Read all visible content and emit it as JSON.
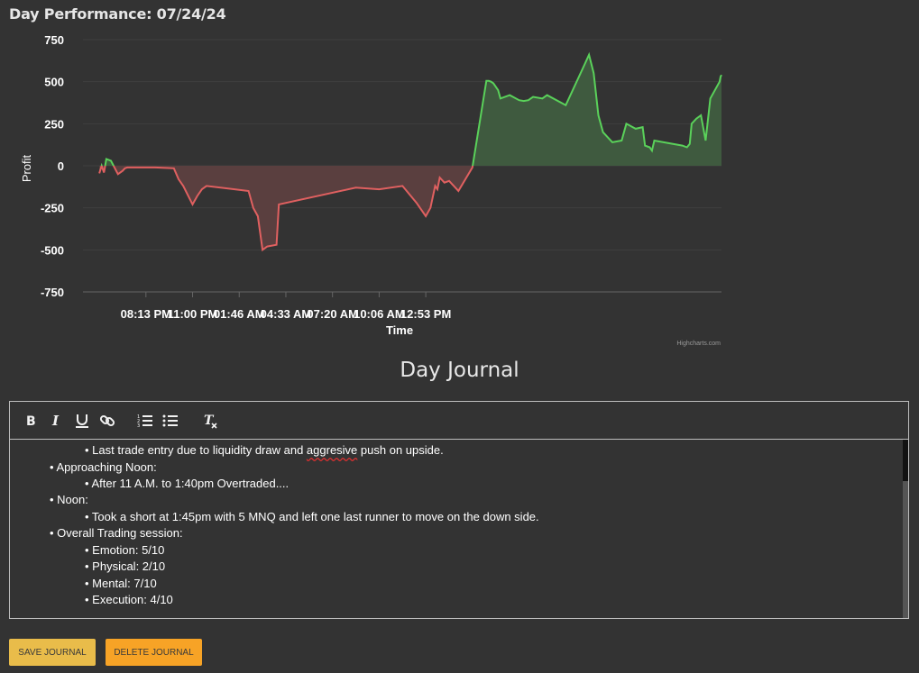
{
  "header": {
    "title": "Day Performance: 07/24/24"
  },
  "chart_data": {
    "type": "area",
    "title": "",
    "xlabel": "Time",
    "ylabel": "Profit",
    "ylim": [
      -750,
      750
    ],
    "yticks": [
      "750",
      "500",
      "250",
      "0",
      "-250",
      "-500",
      "-750"
    ],
    "xticks": [
      "08:13 PM",
      "11:00 PM",
      "01:46 AM",
      "04:33 AM",
      "07:20 AM",
      "10:06 AM",
      "12:53 PM"
    ],
    "grid": true,
    "credits": "Highcharts.com",
    "colors": {
      "positive": "#5ad15a",
      "negative": "#e06060",
      "positive_fill": "#3f5a3f",
      "negative_fill": "#5a3f3f"
    },
    "series": [
      {
        "x": [
          0,
          0.05,
          0.1,
          0.15,
          0.25,
          0.4,
          0.5,
          0.55,
          0.6,
          1.2,
          1.6,
          1.7,
          1.8,
          2.0,
          2.1,
          2.2,
          2.3,
          3.2,
          3.3,
          3.4,
          3.5,
          3.6,
          3.8,
          3.85,
          5.5,
          6.0,
          6.5,
          6.8,
          7.0,
          7.1,
          7.2,
          7.25,
          7.3,
          7.4,
          7.5,
          7.7,
          8.0,
          8.3,
          8.35,
          8.4,
          8.45,
          8.55,
          8.6,
          8.8,
          9.0,
          9.1,
          9.2,
          9.25,
          9.3,
          9.5,
          9.6,
          10.0,
          10.4,
          10.5,
          10.6,
          10.7,
          10.8,
          11.0,
          11.2,
          11.25,
          11.3,
          11.5,
          11.65,
          11.7,
          11.8,
          11.85,
          11.9,
          12.5,
          12.6,
          12.66,
          12.7,
          12.8,
          12.9,
          13.0,
          13.1,
          13.3,
          13.32,
          13.34
        ],
        "y": [
          -45,
          0,
          -40,
          40,
          30,
          -50,
          -30,
          -15,
          -10,
          -10,
          -15,
          -80,
          -120,
          -230,
          -180,
          -140,
          -120,
          -150,
          -250,
          -300,
          -500,
          -480,
          -470,
          -230,
          -130,
          -140,
          -120,
          -220,
          -300,
          -250,
          -120,
          -140,
          -70,
          -100,
          -90,
          -150,
          -10,
          505,
          505,
          500,
          490,
          450,
          400,
          420,
          390,
          385,
          390,
          400,
          410,
          400,
          420,
          360,
          600,
          660,
          550,
          300,
          200,
          140,
          150,
          200,
          250,
          220,
          230,
          120,
          110,
          90,
          150,
          120,
          110,
          130,
          250,
          280,
          300,
          150,
          400,
          500,
          530,
          540
        ]
      }
    ]
  },
  "journal": {
    "title": "Day Journal",
    "lines": [
      {
        "level": 2,
        "text": "• Last trade entry due to liquidity draw and ",
        "misspelled": "aggresive",
        "after": " push on upside."
      },
      {
        "level": 1,
        "text": "• Approaching Noon:"
      },
      {
        "level": 2,
        "text": "• After 11 A.M. to 1:40pm Overtraded...."
      },
      {
        "level": 1,
        "text": "• Noon:"
      },
      {
        "level": 2,
        "text": "• Took a short at 1:45pm with 5 MNQ and left one last runner to move on the down side."
      },
      {
        "level": 1,
        "text": "• Overall Trading session:"
      },
      {
        "level": 2,
        "text": "• Emotion: 5/10"
      },
      {
        "level": 2,
        "text": "• Physical: 2/10"
      },
      {
        "level": 2,
        "text": "• Mental: 7/10"
      },
      {
        "level": 2,
        "text": "• Execution: 4/10"
      }
    ]
  },
  "toolbar": {
    "icons": [
      "bold-icon",
      "italic-icon",
      "underline-icon",
      "link-icon",
      "ordered-list-icon",
      "bullet-list-icon",
      "clear-format-icon"
    ]
  },
  "buttons": {
    "save": "SAVE JOURNAL",
    "delete": "DELETE JOURNAL"
  }
}
